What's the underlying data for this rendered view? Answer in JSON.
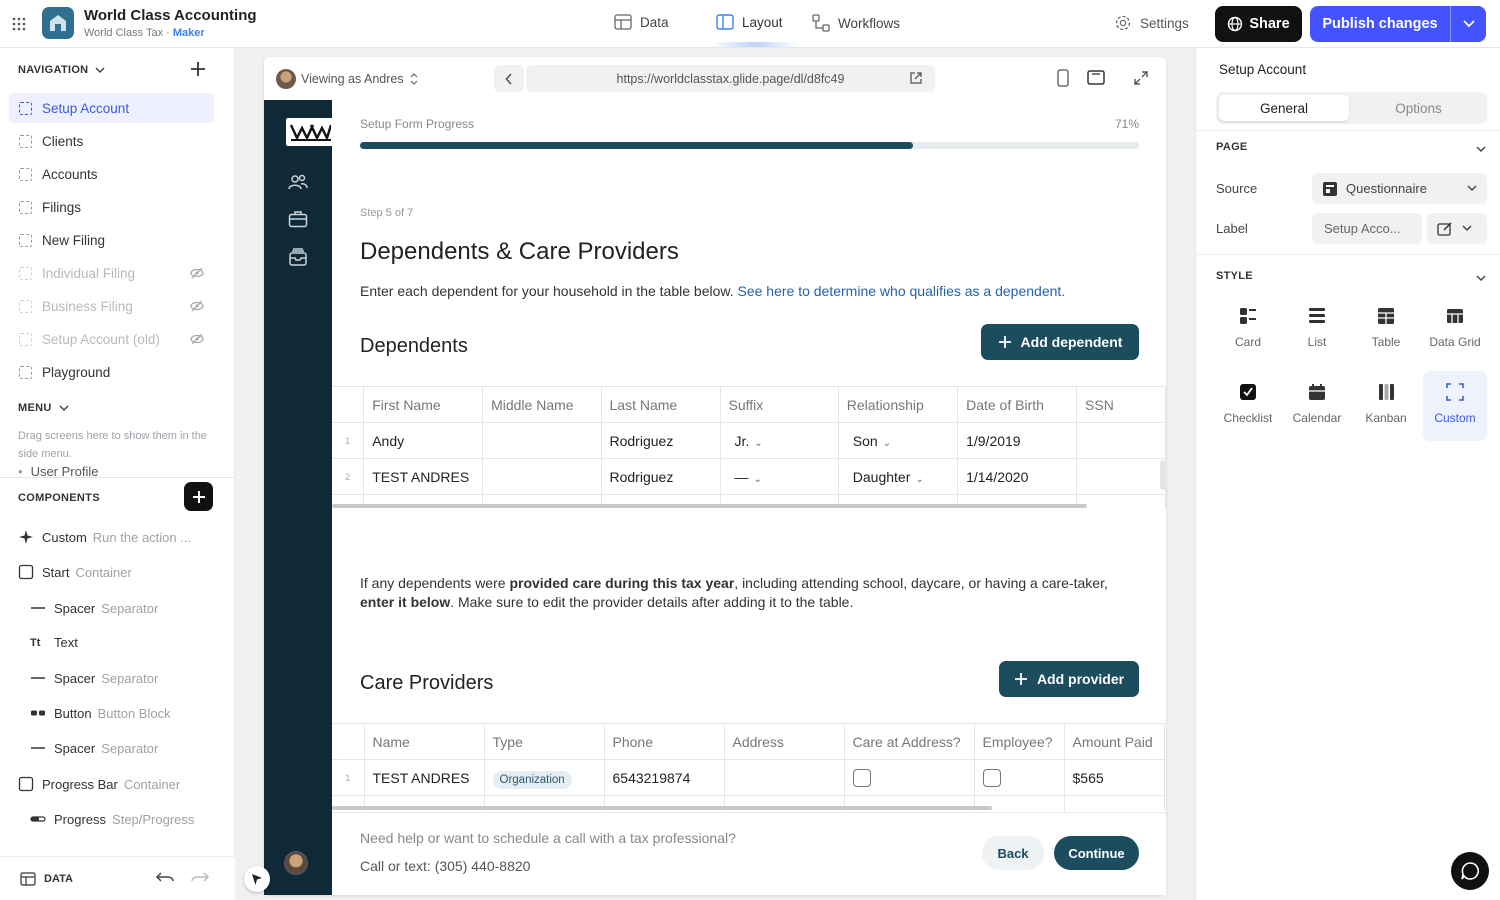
{
  "topbar": {
    "app_name": "World Class Accounting",
    "app_sub": "World Class Tax",
    "app_role": "Maker",
    "tabs": [
      {
        "label": "Data"
      },
      {
        "label": "Layout"
      },
      {
        "label": "Workflows"
      }
    ],
    "settings_label": "Settings",
    "share_label": "Share",
    "publish_label": "Publish changes"
  },
  "navigation": {
    "header": "NAVIGATION",
    "items": [
      {
        "label": "Setup Account"
      },
      {
        "label": "Clients"
      },
      {
        "label": "Accounts"
      },
      {
        "label": "Filings"
      },
      {
        "label": "New Filing"
      },
      {
        "label": "Individual Filing"
      },
      {
        "label": "Business Filing"
      },
      {
        "label": "Setup Account (old)"
      },
      {
        "label": "Playground"
      }
    ]
  },
  "menu": {
    "header": "MENU",
    "hint": "Drag screens here to show them in the side menu.",
    "partial_item": "User Profile"
  },
  "components": {
    "header": "COMPONENTS",
    "items": [
      {
        "name": "Custom",
        "sub": "Run the action ..."
      },
      {
        "name": "Start",
        "sub": "Container"
      },
      {
        "name": "Spacer",
        "sub": "Separator"
      },
      {
        "name": "Text",
        "sub": ""
      },
      {
        "name": "Spacer",
        "sub": "Separator"
      },
      {
        "name": "Button",
        "sub": "Button Block"
      },
      {
        "name": "Spacer",
        "sub": "Separator"
      },
      {
        "name": "Progress Bar",
        "sub": "Container"
      },
      {
        "name": "Progress",
        "sub": "Step/Progress"
      }
    ],
    "footer_label": "DATA"
  },
  "preview_bar": {
    "viewing_as": "Viewing as Andres",
    "url": "https://worldclasstax.glide.page/dl/d8fc49"
  },
  "app": {
    "progress_label": "Setup Form Progress",
    "progress_value": "71%",
    "progress_fraction": 0.71,
    "step": "Step 5 of 7",
    "heading": "Dependents & Care Providers",
    "intro": "Enter each dependent for your household in the table below.",
    "intro_link": "See here to determine who qualifies as a dependent.",
    "dependents_title": "Dependents",
    "add_dependent": "Add dependent",
    "dep_columns": [
      "First Name",
      "Middle Name",
      "Last Name",
      "Suffix",
      "Relationship",
      "Date of Birth",
      "SSN"
    ],
    "dep_rows": [
      {
        "n": "1",
        "first": "Andy",
        "middle": "",
        "last": "Rodriguez",
        "suffix": "Jr.",
        "rel": "Son",
        "dob": "1/9/2019",
        "ssn": ""
      },
      {
        "n": "2",
        "first": "TEST ANDRES",
        "middle": "",
        "last": "Rodriguez",
        "suffix": "—",
        "rel": "Daughter",
        "dob": "1/14/2020",
        "ssn": ""
      }
    ],
    "care_text_1": "If any dependents were ",
    "care_text_bold1": "provided care during this tax year",
    "care_text_2": ", including attending school, daycare, or having a care-taker, ",
    "care_text_bold2": "enter it below",
    "care_text_3": ". Make sure to edit the provider details after adding it to the table.",
    "providers_title": "Care Providers",
    "add_provider": "Add provider",
    "prov_columns": [
      "Name",
      "Type",
      "Phone",
      "Address",
      "Care at Address?",
      "Employee?",
      "Amount Paid"
    ],
    "prov_rows": [
      {
        "n": "1",
        "name": "TEST ANDRES",
        "type": "Organization",
        "phone": "6543219874",
        "address": "",
        "amount": "$565"
      }
    ],
    "help_text": "Need help or want to schedule a call with a tax professional?",
    "call_text": "Call or text: (305) 440-8820",
    "back_label": "Back",
    "continue_label": "Continue"
  },
  "inspector": {
    "title": "Setup Account",
    "tabs": [
      "General",
      "Options"
    ],
    "page_section": "PAGE",
    "source_label": "Source",
    "source_value": "Questionnaire",
    "label_label": "Label",
    "label_value": "Setup Acco...",
    "style_section": "STYLE",
    "styles": [
      {
        "label": "Card"
      },
      {
        "label": "List"
      },
      {
        "label": "Table"
      },
      {
        "label": "Data Grid"
      },
      {
        "label": "Checklist"
      },
      {
        "label": "Calendar"
      },
      {
        "label": "Kanban"
      },
      {
        "label": "Custom"
      }
    ]
  },
  "colors": {
    "accent": "#3b5bdb",
    "publish": "#4353ff",
    "app_dark": "#0f2a36",
    "app_button": "#1b4d5e"
  }
}
